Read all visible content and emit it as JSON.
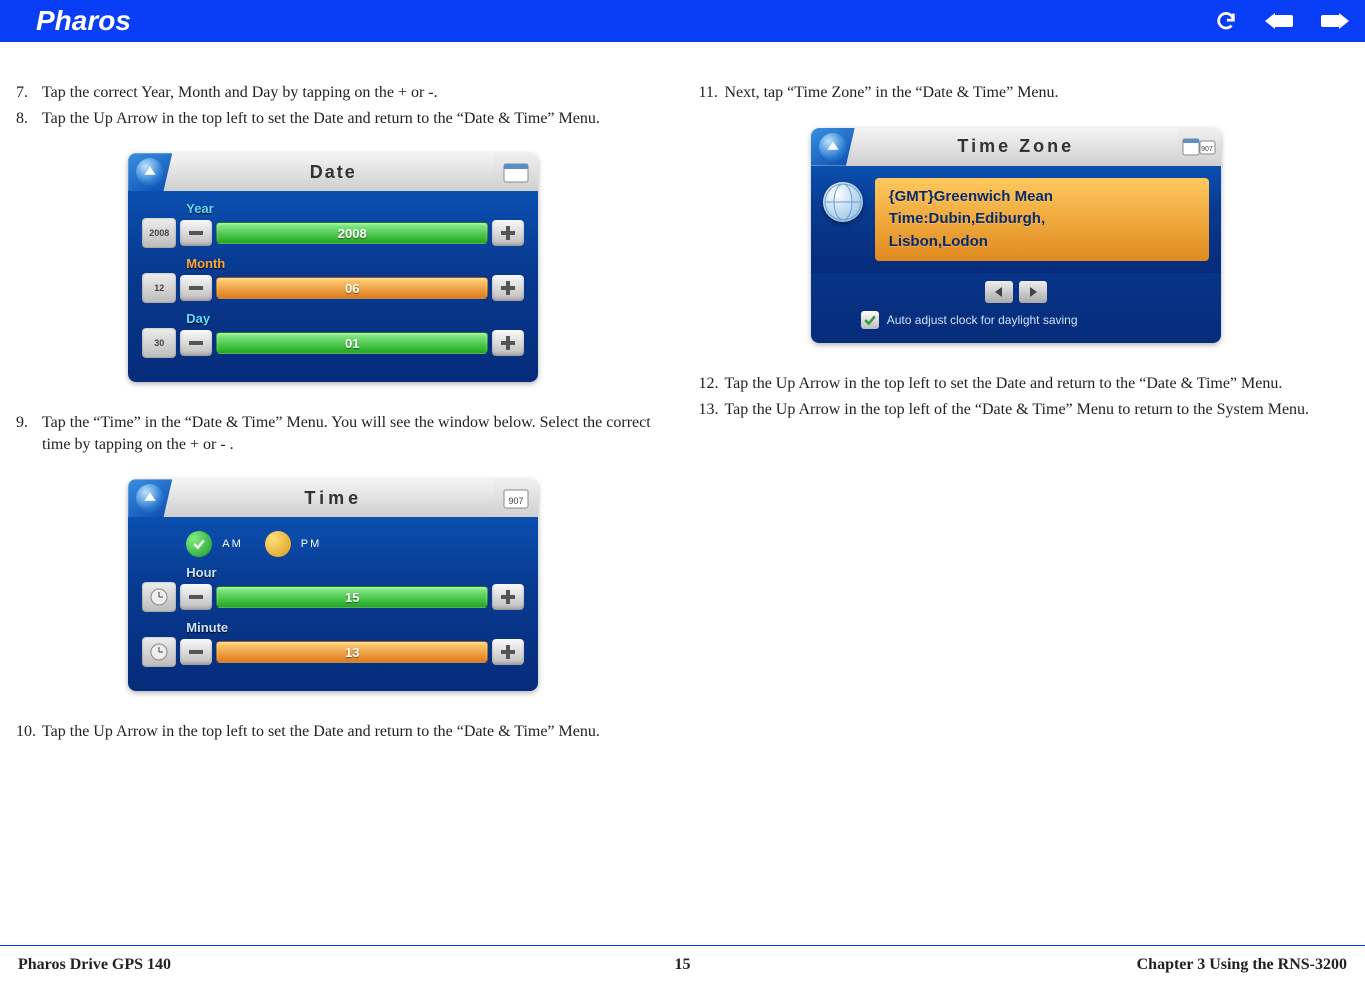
{
  "header": {
    "title": "Pharos"
  },
  "left_col": {
    "steps_a": [
      {
        "n": "7.",
        "t": "Tap the correct Year, Month and Day by tapping on the + or -."
      },
      {
        "n": "8.",
        "t": "Tap the Up Arrow in the top left to set the Date and return to the “Date & Time” Menu."
      }
    ],
    "steps_b": [
      {
        "n": "9.",
        "t": "Tap the “Time” in the “Date & Time” Menu. You will see the window below. Select the correct time by tapping on the + or - ."
      }
    ],
    "steps_c": [
      {
        "n": "10.",
        "t": "Tap the Up Arrow in the top left to set the Date and return to the “Date & Time” Menu."
      }
    ]
  },
  "right_col": {
    "steps_a": [
      {
        "n": "11.",
        "t": "Next, tap “Time Zone” in the “Date & Time” Menu."
      }
    ],
    "steps_b": [
      {
        "n": "12.",
        "t": "Tap the Up Arrow in the top left to set the Date and return to the “Date & Time” Menu."
      },
      {
        "n": "13.",
        "t": "Tap the Up Arrow in the top left of the “Date & Time” Menu to return to the System Menu."
      }
    ]
  },
  "date_panel": {
    "title": "Date",
    "year_lbl": "Year",
    "year_val": "2008",
    "month_lbl": "Month",
    "month_val": "06",
    "day_lbl": "Day",
    "day_val": "01",
    "year_ico": "2008",
    "month_ico": "12",
    "day_ico": "30"
  },
  "time_panel": {
    "title": "Time",
    "am": "AM",
    "pm": "PM",
    "hour_lbl": "Hour",
    "hour_val": "15",
    "minute_lbl": "Minute",
    "minute_val": "13"
  },
  "tz_panel": {
    "title": "Time Zone",
    "line1": "{GMT}Greenwich Mean",
    "line2": "Time:Dubin,Ediburgh,",
    "line3": "Lisbon,Lodon",
    "auto": "Auto adjust clock for daylight saving"
  },
  "footer": {
    "left": "Pharos Drive GPS 140",
    "center": "15",
    "right": "Chapter 3 Using the RNS-3200"
  }
}
